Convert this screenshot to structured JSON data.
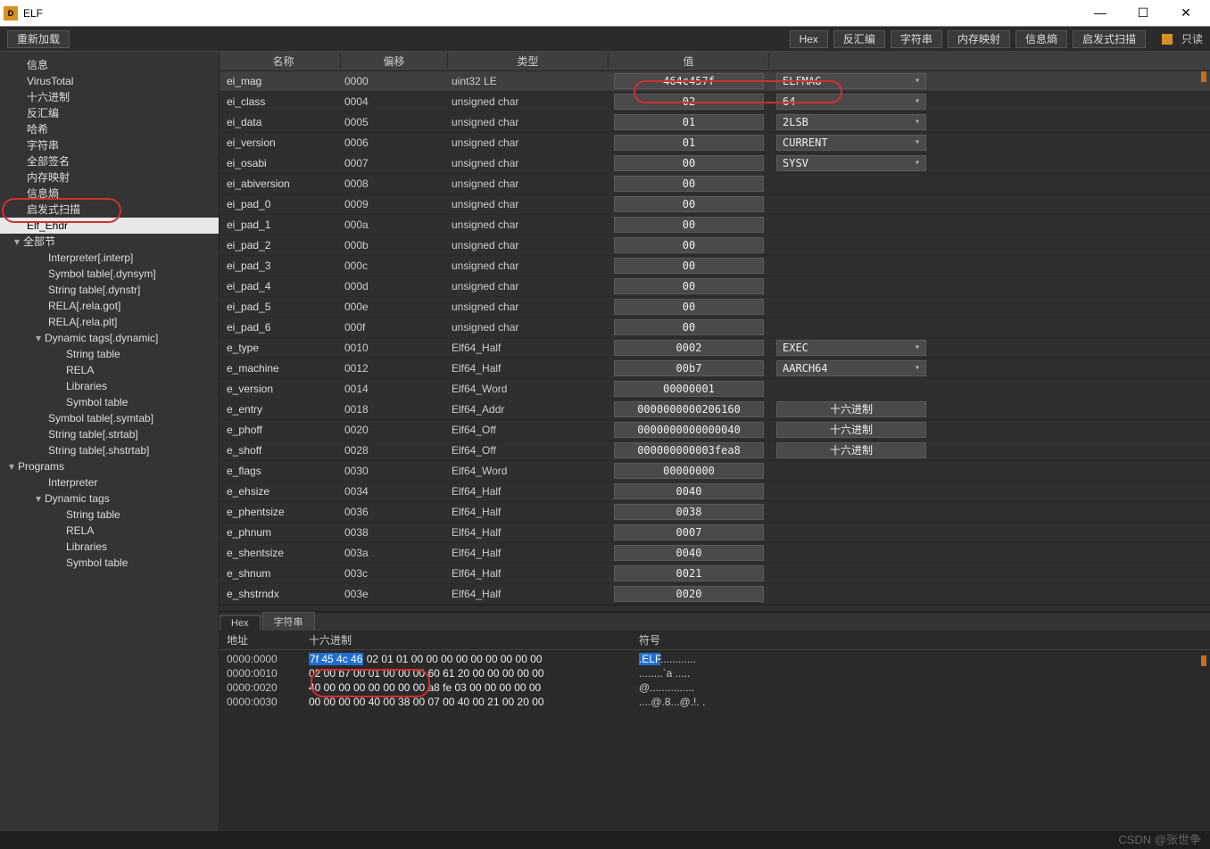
{
  "window": {
    "title": "ELF",
    "logo_text": "D",
    "min": "—",
    "max": "☐",
    "close": "✕"
  },
  "toolbar": {
    "reload": "重新加载",
    "buttons": [
      "Hex",
      "反汇编",
      "字符串",
      "内存映射",
      "信息熵",
      "启发式扫描"
    ],
    "readonly_label": "只读"
  },
  "sidebar": {
    "items": [
      {
        "label": "信息",
        "ind": 1,
        "sel": false
      },
      {
        "label": "VirusTotal",
        "ind": 1
      },
      {
        "label": "十六进制",
        "ind": 1
      },
      {
        "label": "反汇编",
        "ind": 1
      },
      {
        "label": "哈希",
        "ind": 1
      },
      {
        "label": "字符串",
        "ind": 1
      },
      {
        "label": "全部签名",
        "ind": 1
      },
      {
        "label": "内存映射",
        "ind": 1
      },
      {
        "label": "信息熵",
        "ind": 1
      },
      {
        "label": "启发式扫描",
        "ind": 1
      },
      {
        "label": "Elf_Ehdr",
        "ind": 1,
        "sel": true
      },
      {
        "label": "全部节",
        "ind": 1,
        "caret": "▾"
      },
      {
        "label": "Interpreter[.interp]",
        "ind": 2
      },
      {
        "label": "Symbol table[.dynsym]",
        "ind": 2
      },
      {
        "label": "String table[.dynstr]",
        "ind": 2
      },
      {
        "label": "RELA[.rela.got]",
        "ind": 2
      },
      {
        "label": "RELA[.rela.plt]",
        "ind": 2
      },
      {
        "label": "Dynamic tags[.dynamic]",
        "ind": 2,
        "caret": "▾"
      },
      {
        "label": "String table",
        "ind": 3
      },
      {
        "label": "RELA",
        "ind": 3
      },
      {
        "label": "Libraries",
        "ind": 3
      },
      {
        "label": "Symbol table",
        "ind": 3
      },
      {
        "label": "Symbol table[.symtab]",
        "ind": 2
      },
      {
        "label": "String table[.strtab]",
        "ind": 2
      },
      {
        "label": "String table[.shstrtab]",
        "ind": 2
      },
      {
        "label": "Programs",
        "ind": 1,
        "caret": "▾",
        "ind0": true
      },
      {
        "label": "Interpreter",
        "ind": 2
      },
      {
        "label": "Dynamic tags",
        "ind": 2,
        "caret": "▾"
      },
      {
        "label": "String table",
        "ind": 3
      },
      {
        "label": "RELA",
        "ind": 3
      },
      {
        "label": "Libraries",
        "ind": 3
      },
      {
        "label": "Symbol table",
        "ind": 3
      }
    ]
  },
  "grid": {
    "head": {
      "name": "名称",
      "off": "偏移",
      "type": "类型",
      "val": "值"
    },
    "rows": [
      {
        "name": "ei_mag",
        "off": "0000",
        "type": "uint32 LE",
        "val": "464c457f",
        "extra_kind": "drop",
        "extra": "ELFMAG",
        "sel": true
      },
      {
        "name": "ei_class",
        "off": "0004",
        "type": "unsigned char",
        "val": "02",
        "extra_kind": "drop",
        "extra": "64"
      },
      {
        "name": "ei_data",
        "off": "0005",
        "type": "unsigned char",
        "val": "01",
        "extra_kind": "drop",
        "extra": "2LSB"
      },
      {
        "name": "ei_version",
        "off": "0006",
        "type": "unsigned char",
        "val": "01",
        "extra_kind": "drop",
        "extra": "CURRENT"
      },
      {
        "name": "ei_osabi",
        "off": "0007",
        "type": "unsigned char",
        "val": "00",
        "extra_kind": "drop",
        "extra": "SYSV"
      },
      {
        "name": "ei_abiversion",
        "off": "0008",
        "type": "unsigned char",
        "val": "00"
      },
      {
        "name": "ei_pad_0",
        "off": "0009",
        "type": "unsigned char",
        "val": "00"
      },
      {
        "name": "ei_pad_1",
        "off": "000a",
        "type": "unsigned char",
        "val": "00"
      },
      {
        "name": "ei_pad_2",
        "off": "000b",
        "type": "unsigned char",
        "val": "00"
      },
      {
        "name": "ei_pad_3",
        "off": "000c",
        "type": "unsigned char",
        "val": "00"
      },
      {
        "name": "ei_pad_4",
        "off": "000d",
        "type": "unsigned char",
        "val": "00"
      },
      {
        "name": "ei_pad_5",
        "off": "000e",
        "type": "unsigned char",
        "val": "00"
      },
      {
        "name": "ei_pad_6",
        "off": "000f",
        "type": "unsigned char",
        "val": "00"
      },
      {
        "name": "e_type",
        "off": "0010",
        "type": "Elf64_Half",
        "val": "0002",
        "extra_kind": "drop",
        "extra": "EXEC"
      },
      {
        "name": "e_machine",
        "off": "0012",
        "type": "Elf64_Half",
        "val": "00b7",
        "extra_kind": "drop",
        "extra": "AARCH64"
      },
      {
        "name": "e_version",
        "off": "0014",
        "type": "Elf64_Word",
        "val": "00000001"
      },
      {
        "name": "e_entry",
        "off": "0018",
        "type": "Elf64_Addr",
        "val": "0000000000206160",
        "extra_kind": "btn",
        "extra": "十六进制"
      },
      {
        "name": "e_phoff",
        "off": "0020",
        "type": "Elf64_Off",
        "val": "0000000000000040",
        "extra_kind": "btn",
        "extra": "十六进制"
      },
      {
        "name": "e_shoff",
        "off": "0028",
        "type": "Elf64_Off",
        "val": "000000000003fea8",
        "extra_kind": "btn",
        "extra": "十六进制"
      },
      {
        "name": "e_flags",
        "off": "0030",
        "type": "Elf64_Word",
        "val": "00000000"
      },
      {
        "name": "e_ehsize",
        "off": "0034",
        "type": "Elf64_Half",
        "val": "0040"
      },
      {
        "name": "e_phentsize",
        "off": "0036",
        "type": "Elf64_Half",
        "val": "0038"
      },
      {
        "name": "e_phnum",
        "off": "0038",
        "type": "Elf64_Half",
        "val": "0007"
      },
      {
        "name": "e_shentsize",
        "off": "003a",
        "type": "Elf64_Half",
        "val": "0040"
      },
      {
        "name": "e_shnum",
        "off": "003c",
        "type": "Elf64_Half",
        "val": "0021"
      },
      {
        "name": "e_shstrndx",
        "off": "003e",
        "type": "Elf64_Half",
        "val": "0020"
      }
    ]
  },
  "hex": {
    "tab_hex": "Hex",
    "tab_str": "字符串",
    "head_addr": "地址",
    "head_hex": "十六进制",
    "head_sym": "符号",
    "rows": [
      {
        "addr": "0000:0000",
        "pre": "",
        "hl": "7f 45 4c 46",
        "rest": " 02 01 01 00 00 00 00 00 00 00 00 00",
        "sym_hl": ".ELF",
        "sym_rest": "............"
      },
      {
        "addr": "0000:0010",
        "pre": "02 00 b7 00 01 00 00 00 60 61 20 00 00 00 00 00",
        "sym": "........`a ....."
      },
      {
        "addr": "0000:0020",
        "pre": "40 00 00 00 00 00 00 00 a8 fe 03 00 00 00 00 00",
        "sym": "@..............."
      },
      {
        "addr": "0000:0030",
        "pre": "00 00 00 00 40 00 38 00 07 00 40 00 21 00 20 00",
        "sym": "....@.8...@.!. ."
      }
    ]
  },
  "footer": "CSDN @张世争"
}
